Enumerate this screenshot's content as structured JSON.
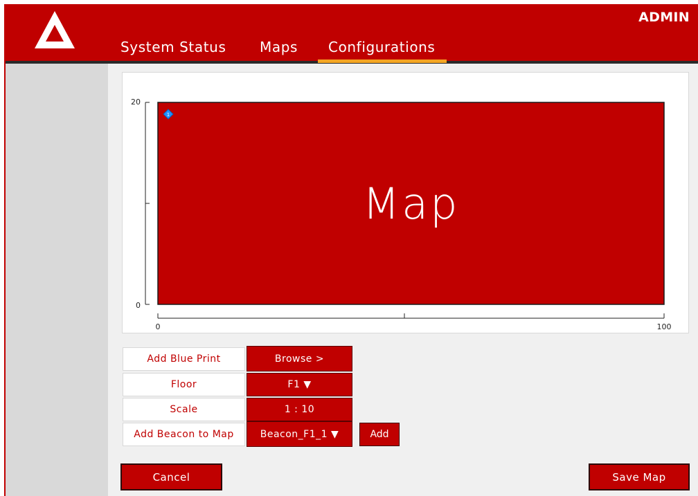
{
  "header": {
    "admin_label": "ADMIN",
    "tabs": [
      {
        "label": "System Status",
        "active": false
      },
      {
        "label": "Maps",
        "active": false
      },
      {
        "label": "Configurations",
        "active": true
      }
    ]
  },
  "map": {
    "label": "Map",
    "y_ticks": [
      "20",
      "0"
    ],
    "x_ticks": [
      "0",
      "100"
    ],
    "beacon_marker": "1",
    "x_range": [
      0,
      100
    ],
    "y_range": [
      0,
      20
    ]
  },
  "form": {
    "rows": [
      {
        "label": "Add Blue Print",
        "value": "Browse >"
      },
      {
        "label": "Floor",
        "value": "F1 ▼"
      },
      {
        "label": "Scale",
        "value": "1 : 10"
      },
      {
        "label": "Add Beacon to Map",
        "value": "Beacon_F1_1 ▼"
      }
    ],
    "add_label": "Add"
  },
  "actions": {
    "cancel_label": "Cancel",
    "save_label": "Save Map"
  },
  "colors": {
    "brand_red": "#c00000",
    "tab_underline": "#f5a623",
    "beacon": "#1e90ff"
  }
}
